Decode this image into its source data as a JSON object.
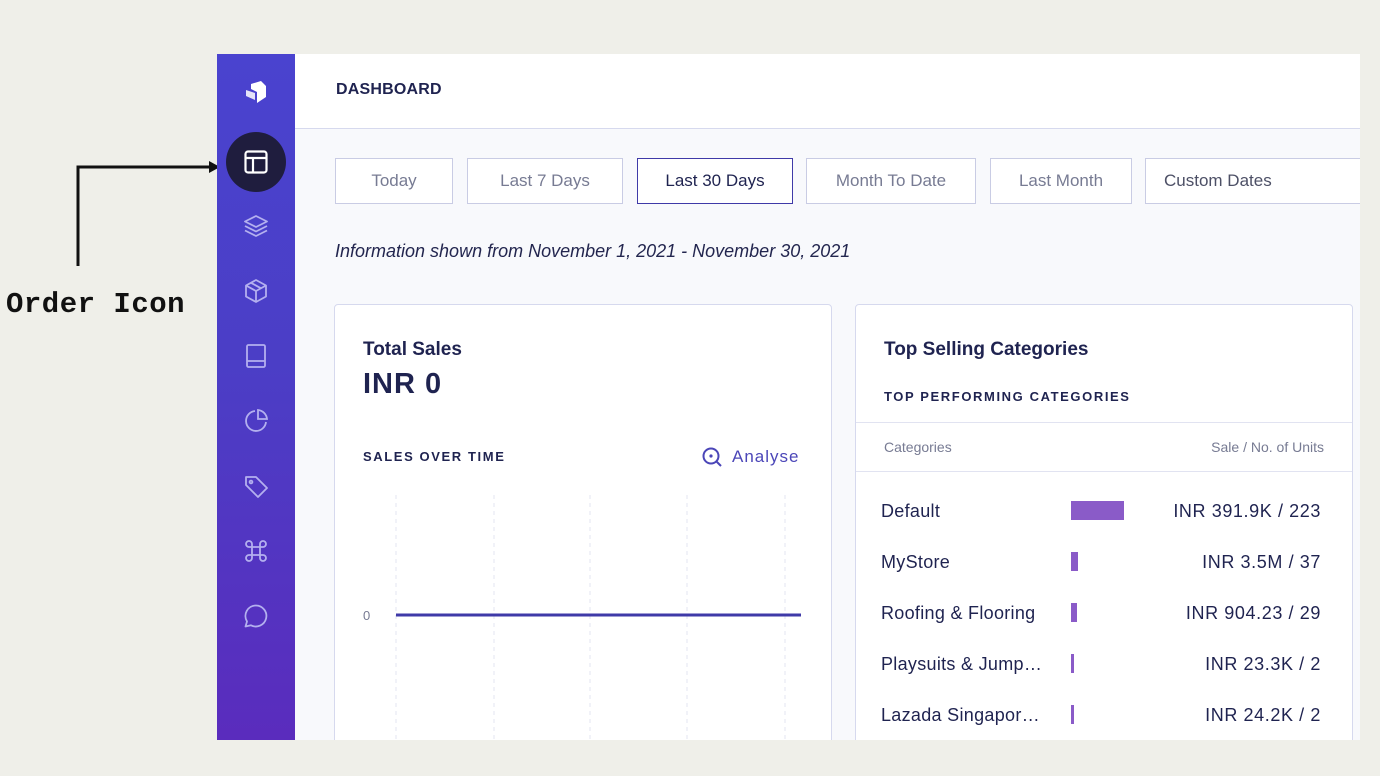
{
  "annotation": {
    "label": "Order Icon"
  },
  "sidebar": {
    "icons": [
      {
        "name": "logo-icon",
        "active": false
      },
      {
        "name": "dashboard-icon",
        "active": true
      },
      {
        "name": "layers-icon",
        "active": false
      },
      {
        "name": "box-icon",
        "active": false
      },
      {
        "name": "book-icon",
        "active": false
      },
      {
        "name": "pie-chart-icon",
        "active": false
      },
      {
        "name": "tag-icon",
        "active": false
      },
      {
        "name": "command-icon",
        "active": false
      },
      {
        "name": "chat-icon",
        "active": false
      }
    ]
  },
  "header": {
    "title": "DASHBOARD"
  },
  "date_ranges": {
    "today": "Today",
    "last7": "Last 7 Days",
    "last30": "Last 30 Days",
    "mtd": "Month To Date",
    "last_month": "Last Month",
    "custom": "Custom Dates",
    "selected": "Last 30 Days"
  },
  "info_text": "Information shown from November 1, 2021 - November 30, 2021",
  "sales_card": {
    "title": "Total Sales",
    "value": "INR  0",
    "section_label": "SALES OVER TIME",
    "analyse_label": "Analyse",
    "chart_data": {
      "type": "line",
      "y_ticks": [
        "0"
      ],
      "series": [
        {
          "values": [
            0,
            0,
            0,
            0,
            0
          ]
        }
      ],
      "grid": true
    }
  },
  "categories_card": {
    "title": "Top Selling Categories",
    "subtitle": "TOP PERFORMING CATEGORIES",
    "col_categories": "Categories",
    "col_sales": "Sale / No. of Units",
    "rows": [
      {
        "name": "Default",
        "value": "INR 391.9K / 223",
        "bar": 1.0
      },
      {
        "name": "MyStore",
        "value": "INR 3.5M / 37",
        "bar": 0.13
      },
      {
        "name": "Roofing & Flooring",
        "value": "INR 904.23 / 29",
        "bar": 0.11
      },
      {
        "name": "Playsuits & Jump…",
        "value": "INR 23.3K / 2",
        "bar": 0.04
      },
      {
        "name": "Lazada Singapor…",
        "value": "INR 24.2K / 2",
        "bar": 0.04
      }
    ],
    "bar_color": "#8a5bc8"
  },
  "colors": {
    "sidebar_top": "#4a43cf",
    "sidebar_bottom": "#5a2cbd",
    "accent": "#3f3aa8",
    "text_dark": "#1f2350"
  }
}
